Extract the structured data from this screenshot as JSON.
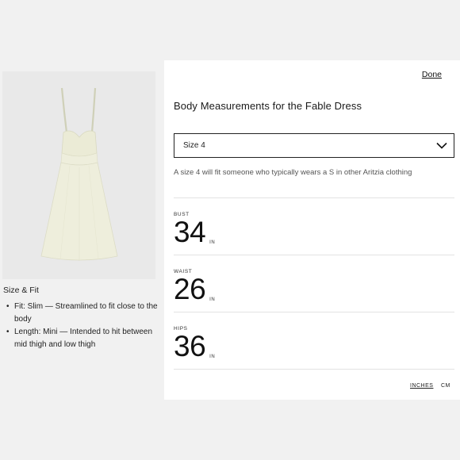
{
  "product": {
    "image_icon": "dress-photo",
    "size_fit_heading": "Size & Fit",
    "fit_items": [
      "Fit: Slim — Streamlined to fit close to the body",
      "Length: Mini — Intended to hit between mid thigh and low thigh"
    ]
  },
  "modal": {
    "done_label": "Done",
    "title": "Body Measurements for the Fable Dress",
    "size_select": {
      "selected": "Size 4",
      "icon": "chevron-down-icon"
    },
    "size_note": "A size 4 will fit someone who typically wears a S in other Aritzia clothing",
    "measurements": [
      {
        "label": "BUST",
        "value": "34",
        "unit": "IN"
      },
      {
        "label": "WAIST",
        "value": "26",
        "unit": "IN"
      },
      {
        "label": "HIPS",
        "value": "36",
        "unit": "IN"
      }
    ],
    "units": {
      "inches": "INCHES",
      "cm": "CM"
    }
  },
  "colors": {
    "background": "#f1f1f1",
    "panel": "#ffffff",
    "dress": "#eeeedc",
    "text": "#1a1a1a"
  }
}
